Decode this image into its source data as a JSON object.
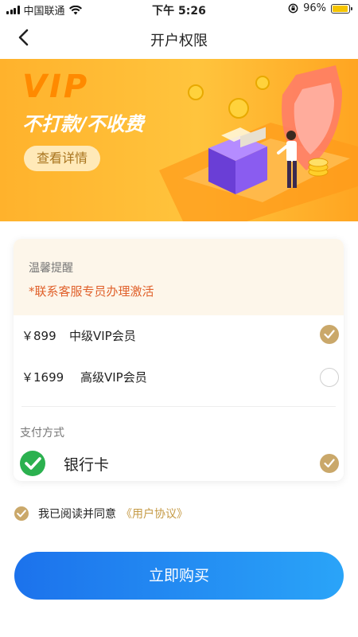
{
  "status_bar": {
    "carrier": "中国联通",
    "time": "下午 5:26",
    "battery": "96%",
    "battery_level": 0.96
  },
  "nav": {
    "title": "开户权限"
  },
  "banner": {
    "vip": "VIP",
    "slogan": "不打款/不收费",
    "detail_label": "查看详情"
  },
  "notice": {
    "title": "温馨提醒",
    "text": "*联系客服专员办理激活"
  },
  "plans": [
    {
      "price": "￥899",
      "name": "中级VIP会员",
      "selected": true
    },
    {
      "price": "￥1699",
      "name": "高级VIP会员",
      "selected": false
    }
  ],
  "payment": {
    "label": "支付方式",
    "method": "银行卡",
    "selected": true
  },
  "agreement": {
    "text": "我已阅读并同意",
    "link": "《用户协议》",
    "checked": true
  },
  "buy_label": "立即购买",
  "colors": {
    "accent_gold": "#caa86a",
    "warning": "#e0602a",
    "button_start": "#1c72ec",
    "button_end": "#2aa4f8",
    "banner": "#ffb22c"
  }
}
